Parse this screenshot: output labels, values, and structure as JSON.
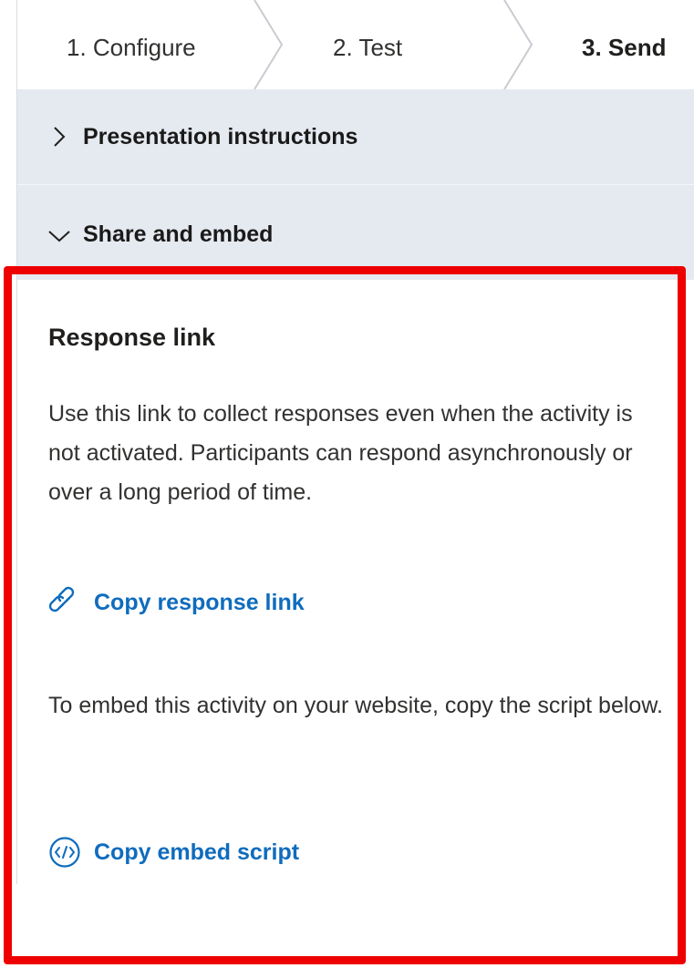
{
  "stepper": {
    "steps": [
      {
        "label": "1. Configure"
      },
      {
        "label": "2. Test"
      },
      {
        "label": "3. Send"
      }
    ],
    "active_step": "3. Send"
  },
  "sections": {
    "presentation": {
      "label": "Presentation instructions",
      "expanded": false,
      "icon": "chevron-right-icon"
    },
    "share": {
      "label": "Share and embed",
      "expanded": true,
      "icon": "chevron-down-icon"
    }
  },
  "share_embed": {
    "title": "Response link",
    "description": "Use this link to collect responses even when the activity is not activated. Participants can respond asynchronously or over a long period of time.",
    "copy_link_label": "Copy response link",
    "copy_link_icon": "link-icon",
    "embed_description": "To embed this activity on your website, copy the script below.",
    "copy_embed_label": "Copy embed script",
    "copy_embed_icon": "code-icon"
  },
  "colors": {
    "accent": "#0f6cbd",
    "header_bg": "#e5eaf1",
    "highlight": "#ee0000"
  }
}
